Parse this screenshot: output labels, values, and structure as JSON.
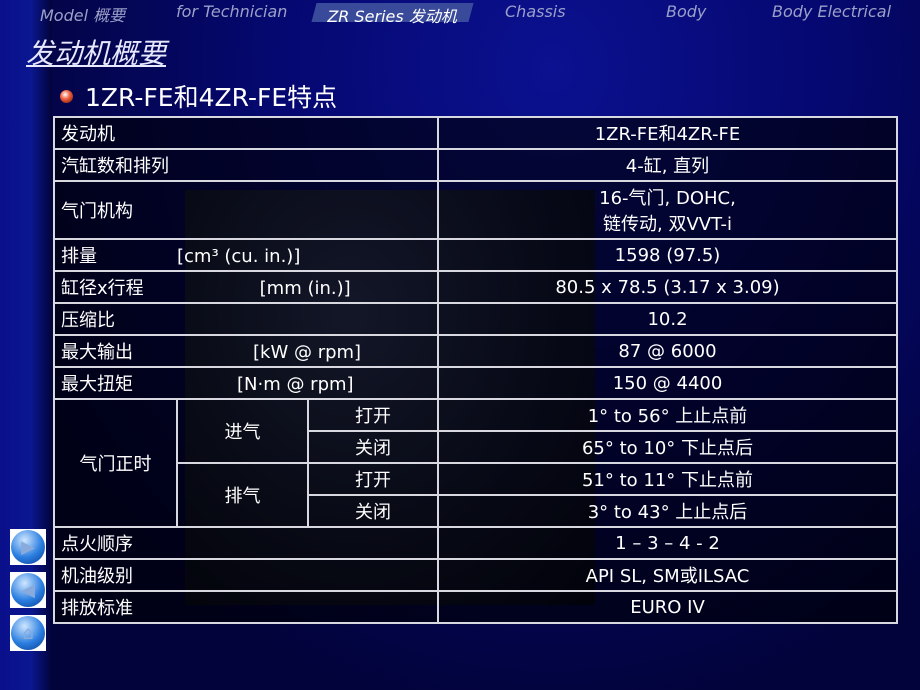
{
  "nav": [
    "Model 概要",
    "for Technician",
    "ZR Series 发动机",
    "Chassis",
    "Body",
    "Body Electrical"
  ],
  "title": "发动机概要",
  "subtitle": "1ZR-FE和4ZR-FE特点",
  "rows": [
    {
      "label": "发动机",
      "value": "1ZR-FE和4ZR-FE"
    },
    {
      "label": "汽缸数和排列",
      "value": "4-缸, 直列"
    },
    {
      "label": "气门机构",
      "value": "16-气门, DOHC,",
      "value2": "链传动, 双VVT-i"
    },
    {
      "label": "排量",
      "unit": "[cm³ (cu. in.)]",
      "value": "1598 (97.5)"
    },
    {
      "label": "缸径x行程",
      "unit": "[mm (in.)]",
      "value": "80.5 x 78.5 (3.17 x 3.09)"
    },
    {
      "label": "压缩比",
      "value": "10.2"
    },
    {
      "label": "最大输出",
      "unit": "[kW @ rpm]",
      "value": "87 @ 6000"
    },
    {
      "label": "最大扭矩",
      "unit": "[N·m @ rpm]",
      "value": "150 @ 4400"
    }
  ],
  "timing": {
    "label": "气门正时",
    "intake": "进气",
    "exhaust": "排气",
    "open": "打开",
    "close": "关闭",
    "values": [
      "1° to 56° 上止点前",
      "65° to 10° 下止点后",
      "51° to 11° 下止点前",
      "3° to 43° 上止点后"
    ]
  },
  "rows2": [
    {
      "label": "点火顺序",
      "value": "1 – 3 – 4 - 2"
    },
    {
      "label": "机油级别",
      "value": "API SL, SM或ILSAC"
    },
    {
      "label": "排放标准",
      "value": "EURO IV"
    }
  ],
  "buttons": [
    "next",
    "previous",
    "home"
  ]
}
